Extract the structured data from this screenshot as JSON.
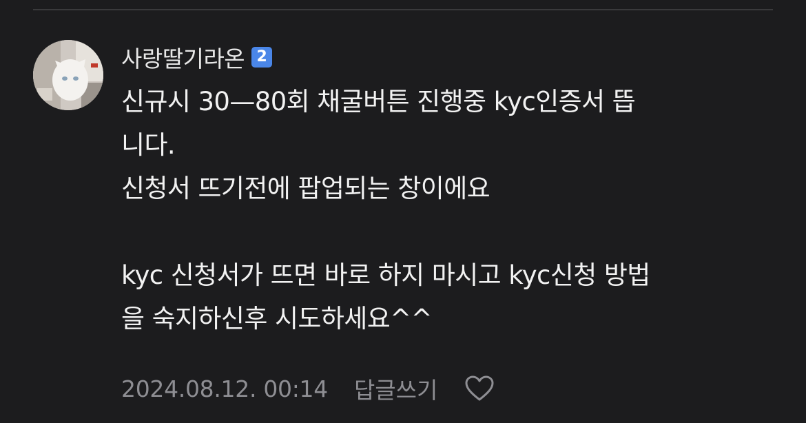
{
  "comment": {
    "author": {
      "name": "사랑딸기라온",
      "level": "2"
    },
    "lines": [
      "신규시 30—80회 채굴버튼 진행중 kyc인증서 뜹",
      "니다.",
      "신청서 뜨기전에 팝업되는 창이에요",
      "",
      "kyc 신청서가 뜨면 바로 하지 마시고 kyc신청 방법",
      "을 숙지하신후 시도하세요^^"
    ],
    "timestamp": "2024.08.12. 00:14",
    "reply_label": "답글쓰기",
    "like_icon": "heart-outline-icon"
  },
  "colors": {
    "background": "#1c1c1e",
    "text": "#f2f2f2",
    "meta": "#8e8e93",
    "badge": "#4a86e8"
  }
}
